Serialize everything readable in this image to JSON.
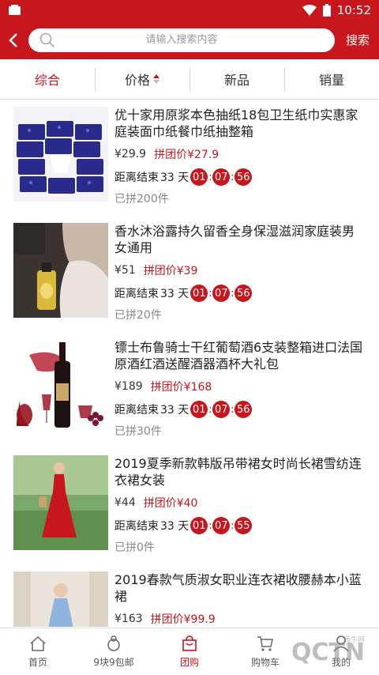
{
  "status_bar": {
    "time": "10:52"
  },
  "header": {
    "search_placeholder": "请输入搜索内容",
    "search_button": "搜索"
  },
  "tabs": [
    {
      "label": "综合",
      "active": true
    },
    {
      "label": "价格",
      "sortable": true
    },
    {
      "label": "新品"
    },
    {
      "label": "销量"
    }
  ],
  "timer_label": "距离结束",
  "products": [
    {
      "title": "优十家用原浆本色抽纸18包卫生纸巾实惠家庭装面巾纸餐巾纸抽整箱",
      "price": "¥29.9",
      "group_price": "拼团价¥27.9",
      "days": "33 天",
      "hours": "01",
      "minutes": "07",
      "seconds": "56",
      "sold": "已拼200件"
    },
    {
      "title": "香水沐浴露持久留香全身保湿滋润家庭装男女通用",
      "price": "¥51",
      "group_price": "拼团价¥39",
      "days": "33 天",
      "hours": "01",
      "minutes": "07",
      "seconds": "56",
      "sold": "已拼20件"
    },
    {
      "title": "镖士布鲁骑士干红葡萄酒6支装整箱进口法国原酒红酒送醒酒器酒杯大礼包",
      "price": "¥189",
      "group_price": "拼团价¥168",
      "days": "33 天",
      "hours": "01",
      "minutes": "07",
      "seconds": "56",
      "sold": "已拼30件"
    },
    {
      "title": "2019夏季新款韩版吊带裙女时尚长裙雪纺连衣裙女装",
      "price": "¥44",
      "group_price": "拼团价¥40",
      "days": "33 天",
      "hours": "01",
      "minutes": "07",
      "seconds": "55",
      "sold": "已拼0件"
    },
    {
      "title": "2019春款气质淑女职业连衣裙收腰赫本小蓝裙",
      "price": "¥163",
      "group_price": "拼团价¥99.9"
    }
  ],
  "bottom_nav": [
    {
      "label": "首页",
      "icon": "home-icon"
    },
    {
      "label": "9块9包邮",
      "icon": "bag-9-icon"
    },
    {
      "label": "团购",
      "icon": "shopping-bag-icon",
      "active": true
    },
    {
      "label": "购物车",
      "icon": "cart-icon"
    },
    {
      "label": "我的",
      "icon": "user-icon"
    }
  ],
  "watermark": {
    "text": "QCTN",
    "small": "腾牛网"
  },
  "colors": {
    "brand_red": "#c8161d"
  }
}
